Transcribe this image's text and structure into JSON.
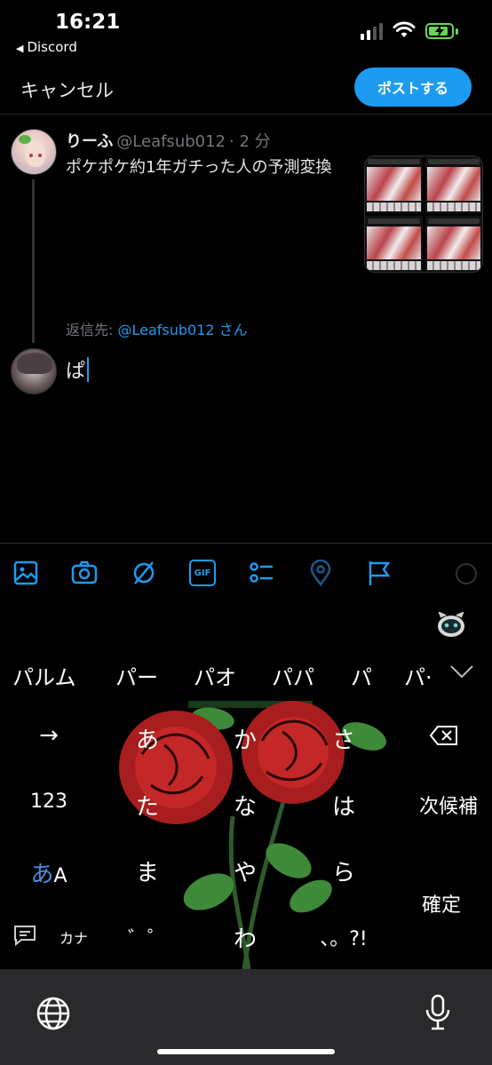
{
  "status_bar": {
    "time": "16:21",
    "back_app": "Discord",
    "back_glyph": "◀"
  },
  "header": {
    "cancel_label": "キャンセル",
    "post_label": "ポストする"
  },
  "tweet": {
    "name": "りーふ",
    "handle": "@Leafsub012",
    "time": "· 2 分",
    "text": "ポケポケ約1年ガチった人の予測変換"
  },
  "reply": {
    "prefix": "返信先:",
    "mention": "@Leafsub012 さん",
    "input_text": "ぱ"
  },
  "toolbar": {
    "icons": [
      "image-icon",
      "camera-icon",
      "gif-off-icon",
      "gif-icon",
      "poll-icon",
      "location-icon",
      "flag-icon"
    ],
    "gif_label": "GIF"
  },
  "candidates": [
    "パルム",
    "パー",
    "パオ",
    "パパ",
    "パ",
    "パ·"
  ],
  "keyboard": {
    "arrow": "→",
    "row1": [
      "あ",
      "か",
      "さ"
    ],
    "row2": [
      "た",
      "な",
      "は"
    ],
    "row3": [
      "ま",
      "や",
      "ら"
    ],
    "row4": [
      "゛゜",
      "わ",
      "、。?!"
    ],
    "num_key": "123",
    "next_cand": "次候補",
    "mode_a": "あ",
    "mode_b": "A",
    "confirm": "確定",
    "kana": "カナ"
  },
  "colors": {
    "accent": "#1d9bf0",
    "background": "#000000",
    "muted": "#71767b"
  }
}
